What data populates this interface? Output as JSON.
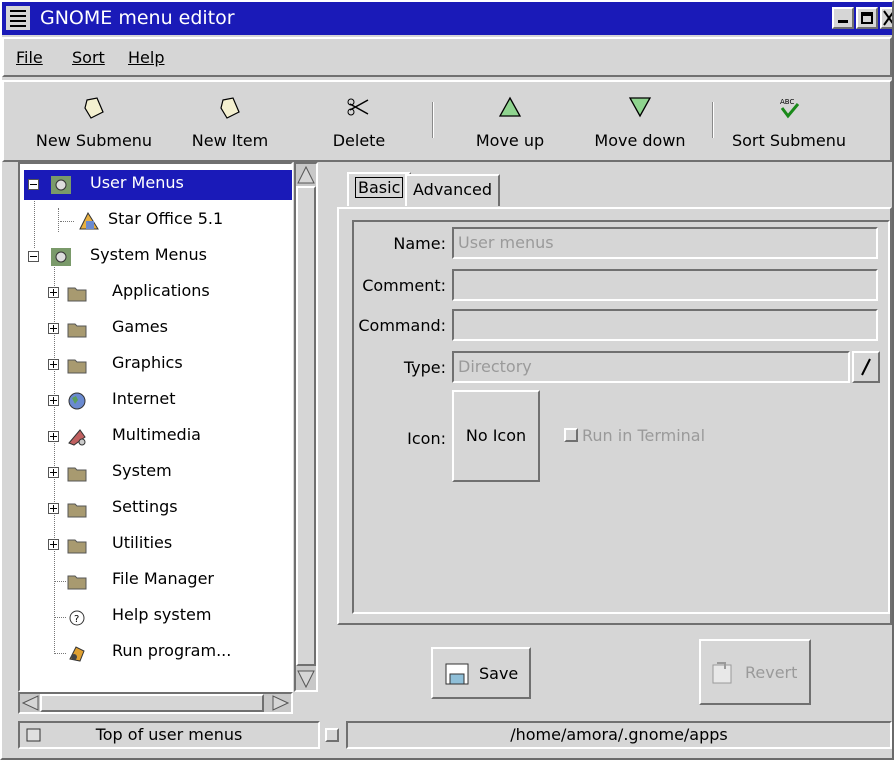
{
  "window": {
    "title": "GNOME menu editor"
  },
  "menubar": {
    "file": "File",
    "sort": "Sort",
    "help": "Help"
  },
  "toolbar": {
    "new_submenu": "New Submenu",
    "new_item": "New Item",
    "delete": "Delete",
    "move_up": "Move up",
    "move_down": "Move down",
    "sort_submenu": "Sort Submenu"
  },
  "tree": {
    "user_menus": "User Menus",
    "star_office": "Star Office 5.1",
    "system_menus": "System Menus",
    "items": [
      "Applications",
      "Games",
      "Graphics",
      "Internet",
      "Multimedia",
      "System",
      "Settings",
      "Utilities",
      "File Manager",
      "Help system",
      "Run program..."
    ]
  },
  "tabs": {
    "basic": "Basic",
    "advanced": "Advanced"
  },
  "form": {
    "name_label": "Name:",
    "name_value": "User menus",
    "comment_label": "Comment:",
    "comment_value": "",
    "command_label": "Command:",
    "command_value": "",
    "type_label": "Type:",
    "type_value": "Directory",
    "icon_label": "Icon:",
    "icon_button": "No Icon",
    "run_in_terminal": "Run in Terminal"
  },
  "buttons": {
    "save": "Save",
    "revert": "Revert"
  },
  "status": {
    "left": "Top of user menus",
    "right": "/home/amora/.gnome/apps"
  },
  "colors": {
    "selection": "#1a1ab8",
    "background": "#d6d6d6"
  }
}
